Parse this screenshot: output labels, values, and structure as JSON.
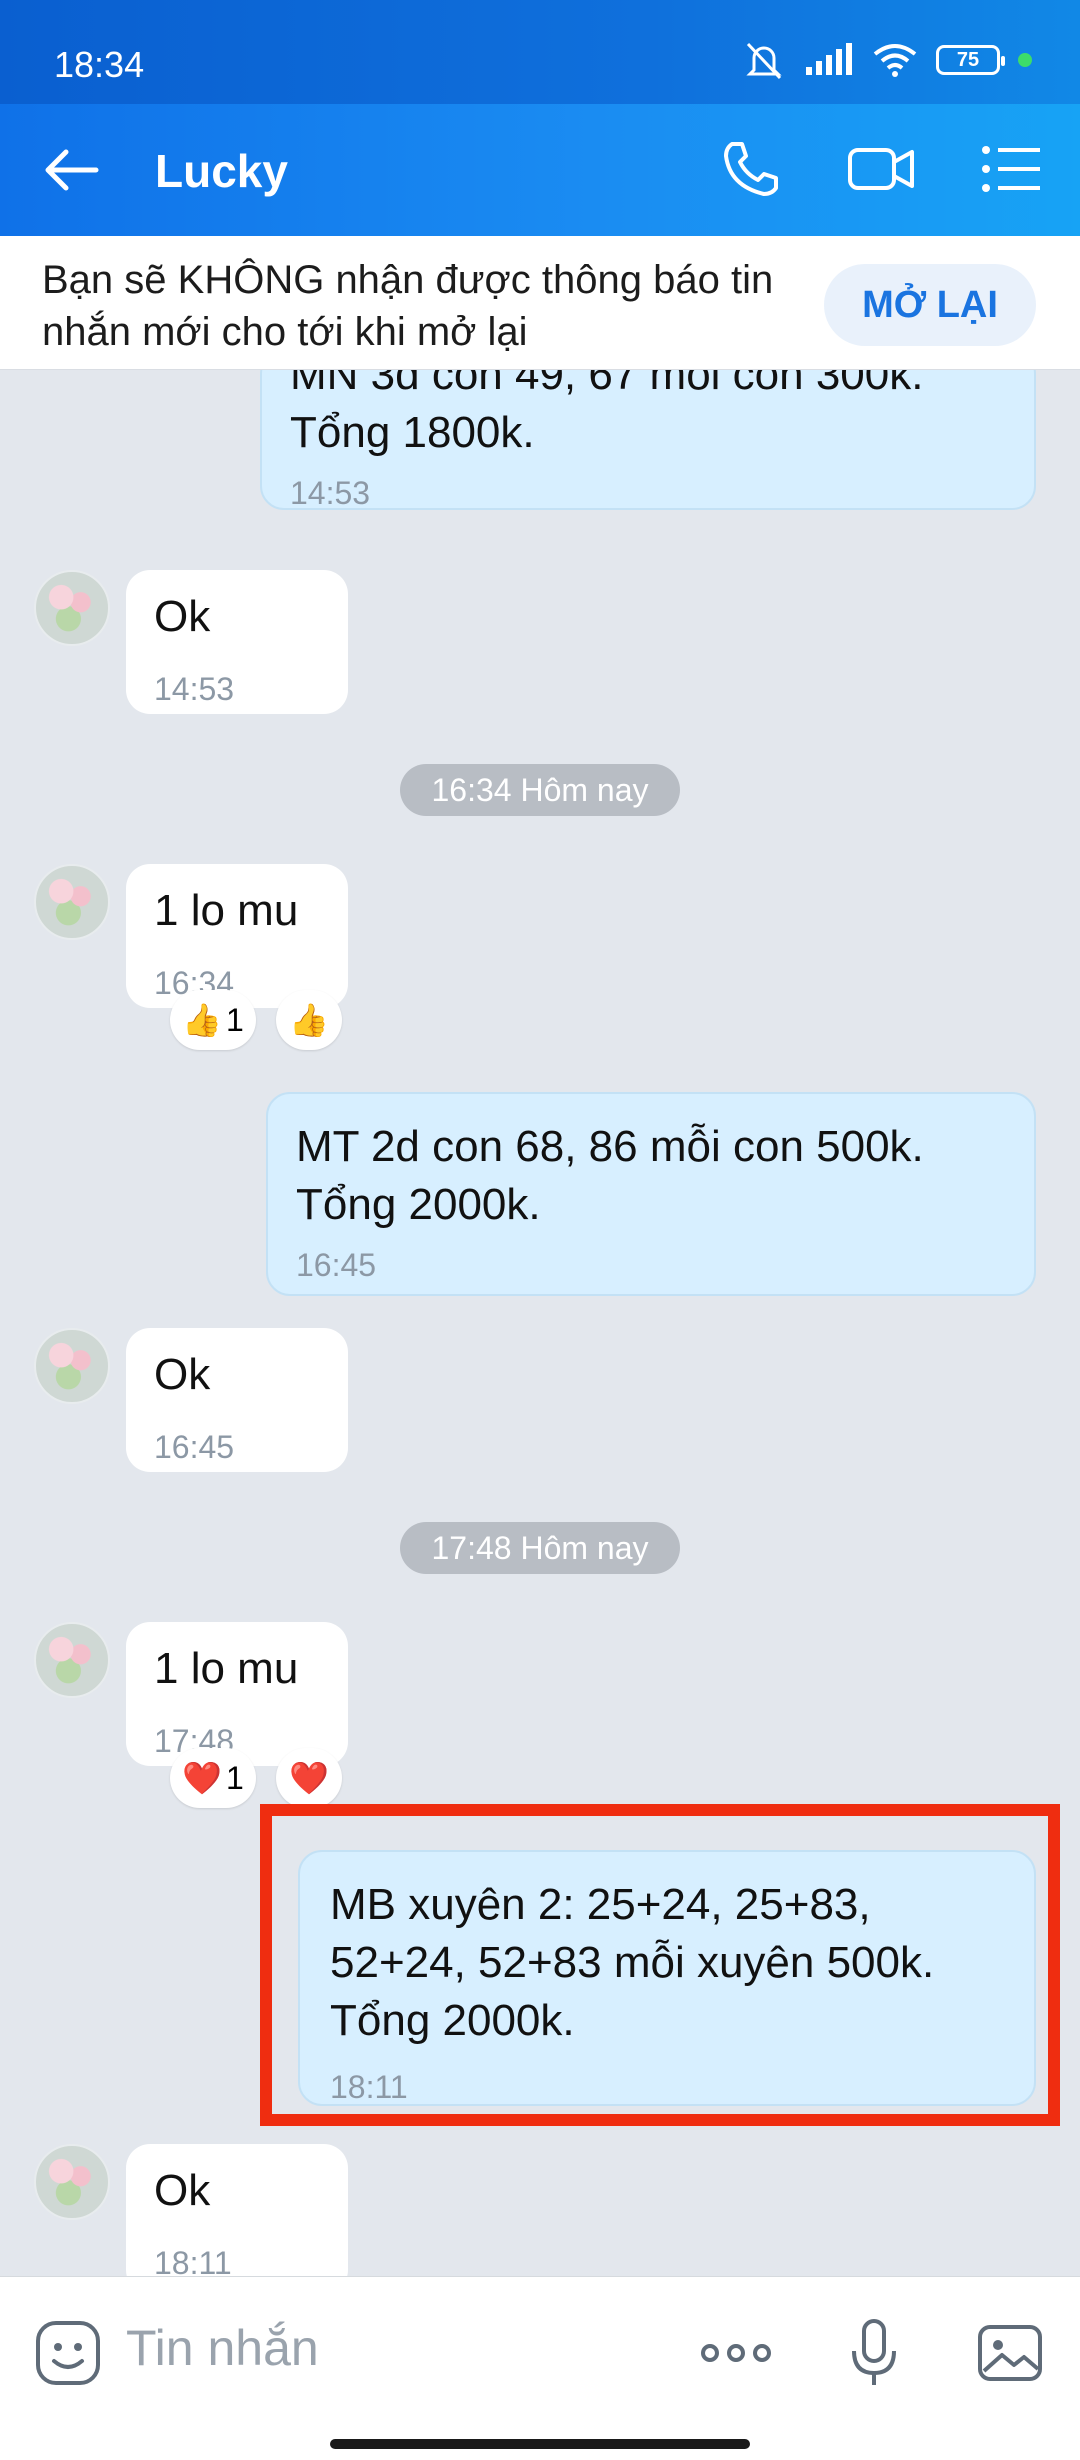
{
  "status": {
    "time": "18:34",
    "battery": "75"
  },
  "header": {
    "title": "Lucky"
  },
  "notice": {
    "text": "Bạn sẽ KHÔNG nhận được thông báo tin nhắn mới cho tới khi mở lại",
    "button": "MỞ LẠI"
  },
  "messages": [
    {
      "dir": "out",
      "text": "MN 3d con 49, 67 mỗi con 300k.\nTổng 1800k.",
      "time": "14:53"
    },
    {
      "dir": "in",
      "text": "Ok",
      "time": "14:53"
    },
    {
      "dir": "in",
      "text": "1 lo mu",
      "time": "16:34"
    },
    {
      "dir": "out",
      "text": "MT 2d con 68, 86 mỗi con 500k.\nTổng 2000k.",
      "time": "16:45"
    },
    {
      "dir": "in",
      "text": "Ok",
      "time": "16:45"
    },
    {
      "dir": "in",
      "text": "1 lo mu",
      "time": "17:48"
    },
    {
      "dir": "out",
      "text": "MB xuyên 2: 25+24, 25+83,\n52+24, 52+83 mỗi xuyên 500k.\nTổng 2000k.",
      "time": "18:11"
    },
    {
      "dir": "in",
      "text": "Ok",
      "time": "18:11"
    }
  ],
  "date_separators": [
    "16:34 Hôm nay",
    "17:48 Hôm nay"
  ],
  "reactions": {
    "first": {
      "emoji": "👍",
      "count": "1",
      "quick": "👍"
    },
    "second": {
      "emoji": "❤️",
      "count": "1",
      "quick": "❤️"
    }
  },
  "composer": {
    "placeholder": "Tin nhắn"
  },
  "colors": {
    "header": "#1a8cf2",
    "outgoing": "#d7efff",
    "highlight": "#ef2d10",
    "accent": "#1a74e0"
  },
  "icons": [
    "back-arrow-icon",
    "phone-icon",
    "video-call-icon",
    "menu-list-icon",
    "sticker-icon",
    "more-icon",
    "microphone-icon",
    "image-icon"
  ]
}
